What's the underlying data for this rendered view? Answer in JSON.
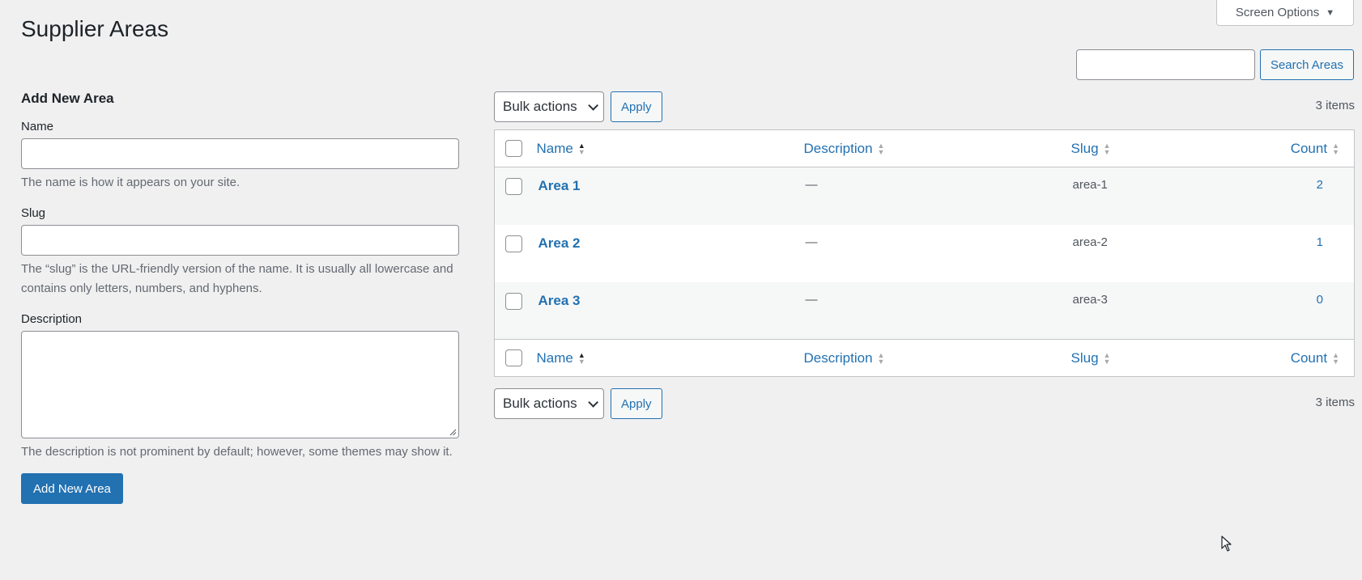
{
  "screen_options": {
    "label": "Screen Options",
    "caret": "▼"
  },
  "page_title": "Supplier Areas",
  "search": {
    "button_label": "Search Areas",
    "value": "",
    "placeholder": ""
  },
  "form": {
    "heading": "Add New Area",
    "name_label": "Name",
    "name_help": "The name is how it appears on your site.",
    "slug_label": "Slug",
    "slug_help": "The “slug” is the URL-friendly version of the name. It is usually all lowercase and contains only letters, numbers, and hyphens.",
    "description_label": "Description",
    "description_help": "The description is not prominent by default; however, some themes may show it.",
    "submit_label": "Add New Area"
  },
  "tablenav": {
    "bulk_actions_label": "Bulk actions",
    "apply_label": "Apply",
    "items_count": "3 items"
  },
  "table": {
    "columns": {
      "name": "Name",
      "description": "Description",
      "slug": "Slug",
      "count": "Count"
    },
    "rows": [
      {
        "name": "Area 1",
        "description": "—",
        "slug": "area-1",
        "count": "2"
      },
      {
        "name": "Area 2",
        "description": "—",
        "slug": "area-2",
        "count": "1"
      },
      {
        "name": "Area 3",
        "description": "—",
        "slug": "area-3",
        "count": "0"
      }
    ]
  },
  "icons": {
    "sort": "sort-arrows-icon",
    "chevron": "chevron-down-icon",
    "cursor": "mouse-pointer-icon"
  },
  "colors": {
    "accent": "#2271b1",
    "background": "#f0f0f1"
  }
}
